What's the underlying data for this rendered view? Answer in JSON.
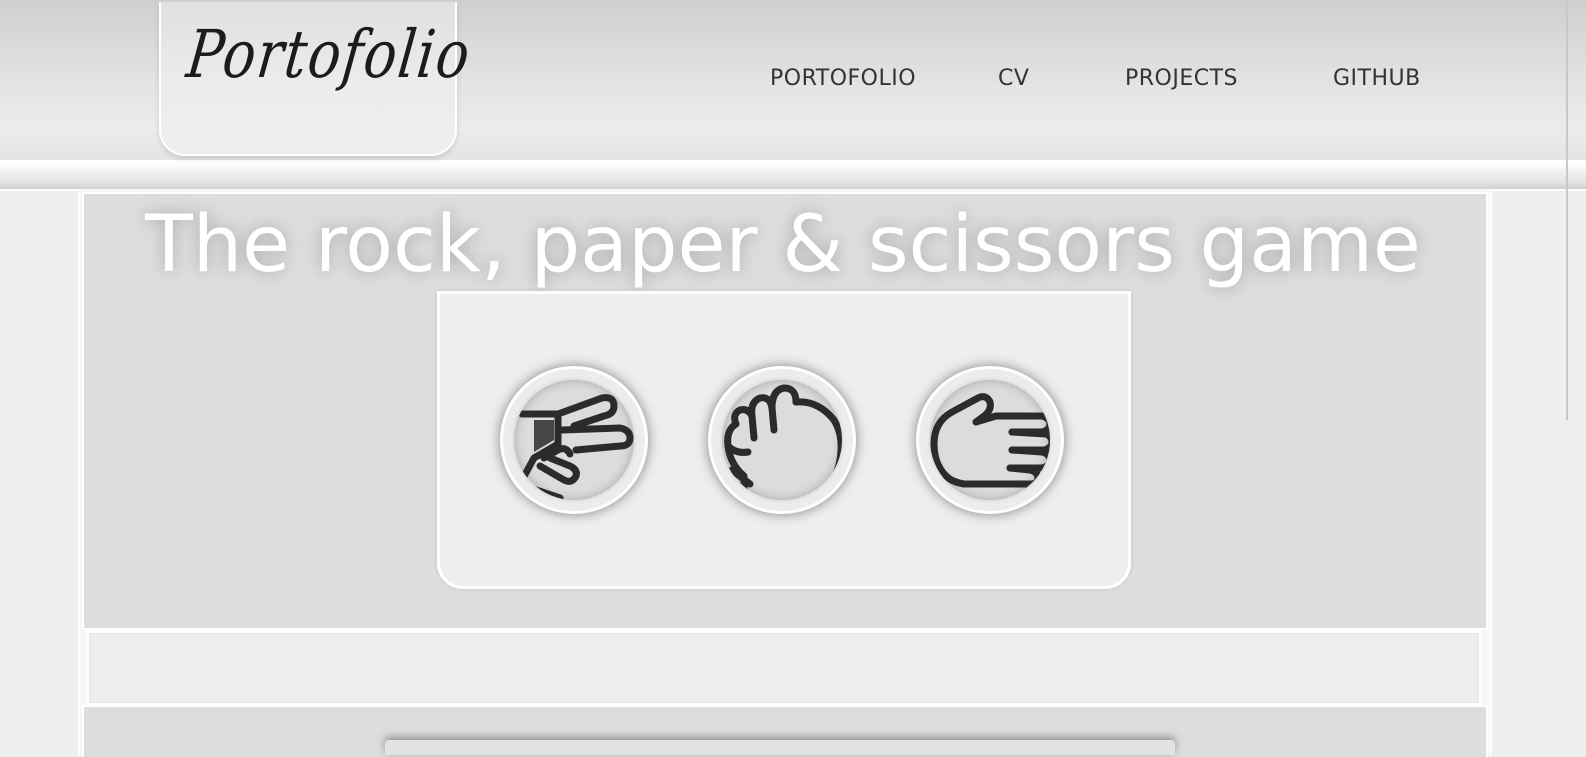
{
  "header": {
    "logo": "Portofolio",
    "nav": [
      {
        "label": "PORTOFOLIO"
      },
      {
        "label": "CV"
      },
      {
        "label": "PROJECTS"
      },
      {
        "label": "GITHUB"
      }
    ]
  },
  "game": {
    "title": "The rock, paper & scissors game",
    "choices": [
      {
        "name": "scissors",
        "icon": "scissors-hand-icon"
      },
      {
        "name": "rock",
        "icon": "fist-icon"
      },
      {
        "name": "paper",
        "icon": "open-hand-icon"
      }
    ],
    "result": ""
  },
  "colors": {
    "page_background": "#efefef",
    "panel": "#dddddd",
    "card": "#eeeeee",
    "icon_stroke": "#2b2b2b",
    "border": "#ffffff"
  }
}
